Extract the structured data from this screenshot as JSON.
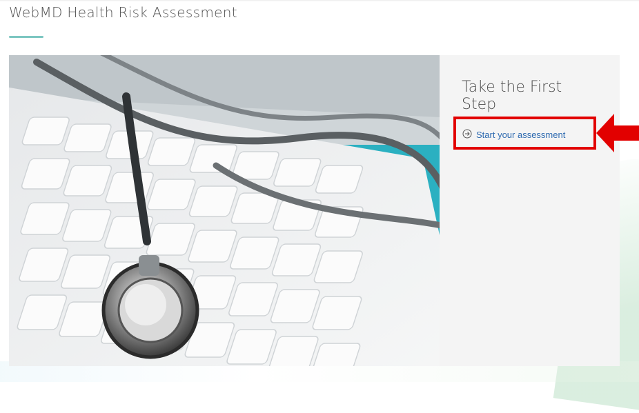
{
  "header": {
    "title": "WebMD Health Risk Assessment"
  },
  "card": {
    "image": {
      "subject": "stethoscope-on-keyboard"
    },
    "heading": "Take the First Step",
    "link": {
      "label": "Start your assessment",
      "icon": "arrow-circle-right-icon"
    }
  },
  "colors": {
    "accent": "#7cc6c1",
    "link": "#2e6ab0",
    "highlight": "#e20000",
    "card_background": "#f4f4f4"
  }
}
